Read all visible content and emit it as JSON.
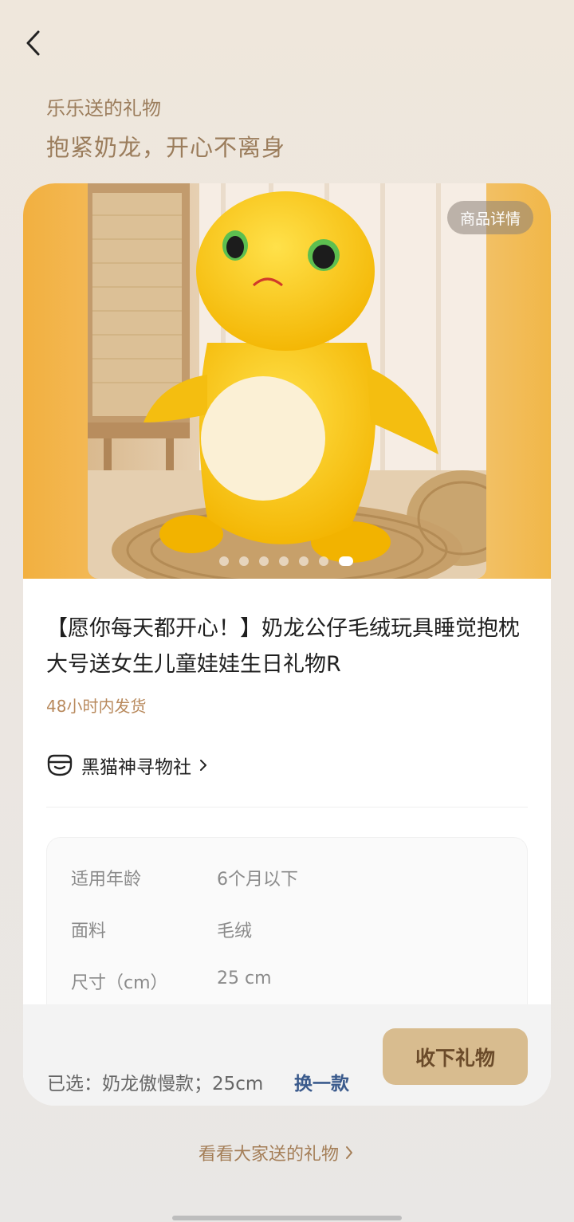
{
  "header": {
    "from_text": "乐乐送的礼物",
    "title": "抱紧奶龙，开心不离身"
  },
  "gallery": {
    "detail_button": "商品详情",
    "dot_count": 7,
    "active_dot": 7
  },
  "product": {
    "title": "【愿你每天都开心！】奶龙公仔毛绒玩具睡觉抱枕大号送女生儿童娃娃生日礼物R",
    "shipping": "48小时内发货"
  },
  "store": {
    "name": "黑猫神寻物社",
    "icon": "cat-store-icon"
  },
  "specs": [
    {
      "key": "适用年龄",
      "value": "6个月以下"
    },
    {
      "key": "面料",
      "value": "毛绒"
    },
    {
      "key": "尺寸（cm）",
      "value": "25 cm"
    }
  ],
  "bottom_bar": {
    "selected": "已选：奶龙傲慢款；25cm",
    "swap_label": "换一款",
    "accept_label": "收下礼物"
  },
  "footer": {
    "see_all": "看看大家送的礼物"
  },
  "colors": {
    "accent_brown": "#9b7d5c",
    "button_bg": "#d8bc8f",
    "swap_blue": "#3a5a8c"
  }
}
